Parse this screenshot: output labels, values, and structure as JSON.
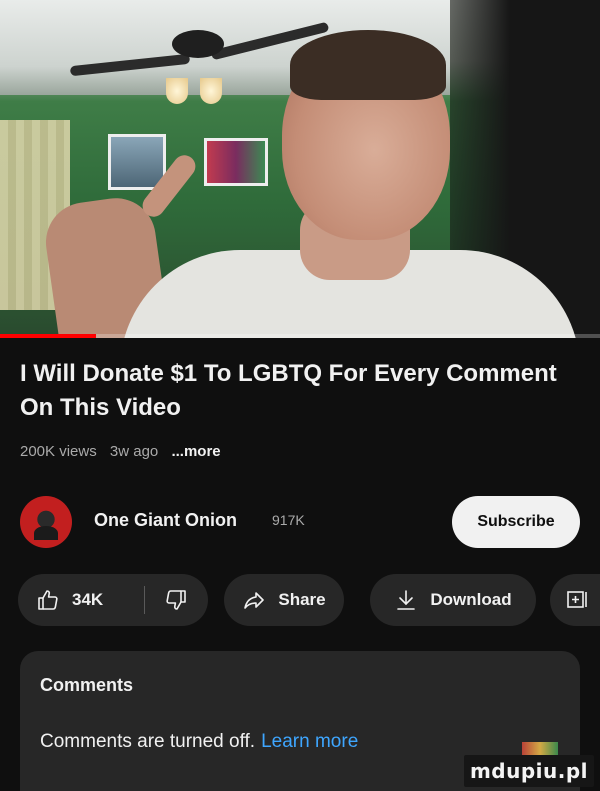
{
  "video": {
    "progress_fraction": 0.16,
    "progress_color": "#ff0000"
  },
  "info": {
    "title": "I Will Donate $1 To LGBTQ For Every Comment On This Video",
    "views": "200K views",
    "age": "3w ago",
    "more_label": "...more"
  },
  "channel": {
    "name": "One Giant Onion",
    "subscribers": "917K",
    "subscribe_label": "Subscribe"
  },
  "actions": {
    "like_count": "34K",
    "like_icon": "thumbs-up-icon",
    "dislike_icon": "thumbs-down-icon",
    "share_label": "Share",
    "share_icon": "share-arrow-icon",
    "download_label": "Download",
    "download_icon": "download-arrow-icon",
    "save_icon": "save-playlist-icon"
  },
  "comments": {
    "heading": "Comments",
    "disabled_text": "Comments are turned off.",
    "learn_more": "Learn more",
    "link_color": "#3ea6ff"
  },
  "watermark": {
    "text": "mdupiu.pl"
  }
}
